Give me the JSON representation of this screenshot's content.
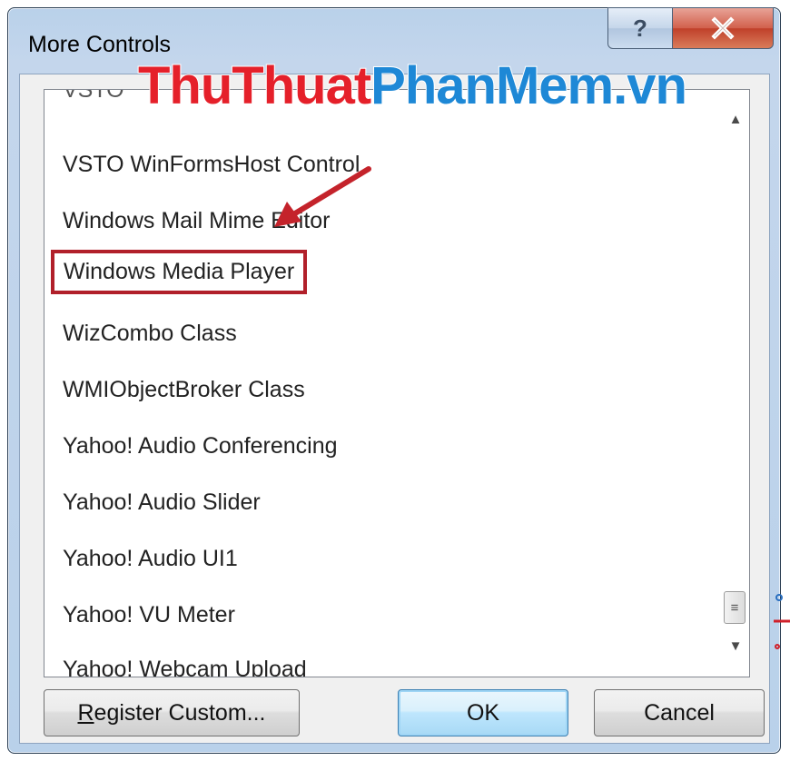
{
  "window": {
    "title": "More Controls"
  },
  "title_buttons": {
    "help": "?",
    "close": "X"
  },
  "watermark": {
    "part1": "ThuThuat",
    "part2": "PhanMem.vn"
  },
  "list": {
    "partial_top": "VSTO",
    "items": [
      "VSTO WinFormsHost Control",
      "Windows Mail Mime Editor",
      "Windows Media Player",
      "WizCombo Class",
      "WMIObjectBroker Class",
      "Yahoo! Audio Conferencing",
      "Yahoo! Audio Slider",
      "Yahoo! Audio UI1",
      "Yahoo! VU Meter",
      "Yahoo! Webcam Upload"
    ],
    "highlighted": "Windows Media Player"
  },
  "buttons": {
    "register_prefix": "R",
    "register_rest": "egister Custom...",
    "ok": "OK",
    "cancel": "Cancel"
  },
  "icons": {
    "scroll_up": "chevron-up-icon",
    "scroll_down": "chevron-down-icon",
    "scroll_grip": "grip-icon",
    "annotation_arrow": "red-arrow-icon"
  },
  "colors": {
    "highlight_border": "#b1202a",
    "arrow": "#c4232b",
    "watermark_red": "#e5202a",
    "watermark_blue": "#1e88d6"
  }
}
